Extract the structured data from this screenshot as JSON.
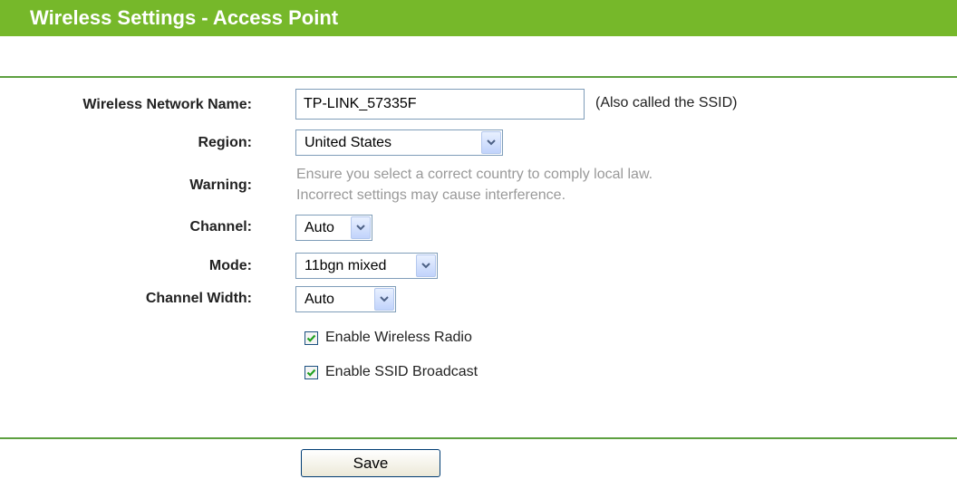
{
  "header": {
    "title": "Wireless Settings - Access Point",
    "color": "#76b82a"
  },
  "form": {
    "ssid": {
      "label": "Wireless Network Name:",
      "value": "TP-LINK_57335F",
      "hint": "(Also called the SSID)"
    },
    "region": {
      "label": "Region:",
      "selected": "United States"
    },
    "warning": {
      "label": "Warning:",
      "line1": "Ensure you select a correct country to comply local law.",
      "line2": "Incorrect settings may cause interference."
    },
    "channel": {
      "label": "Channel:",
      "selected": "Auto"
    },
    "mode": {
      "label": "Mode:",
      "selected": "11bgn mixed"
    },
    "channel_width": {
      "label": "Channel Width:",
      "selected": "Auto"
    },
    "enable_radio": {
      "label": "Enable Wireless Radio",
      "checked": true
    },
    "enable_ssid_broadcast": {
      "label": "Enable SSID Broadcast",
      "checked": true
    }
  },
  "actions": {
    "save_label": "Save"
  },
  "icons": {
    "dropdown": "chevron-down-icon",
    "checkbox": "check-icon"
  }
}
